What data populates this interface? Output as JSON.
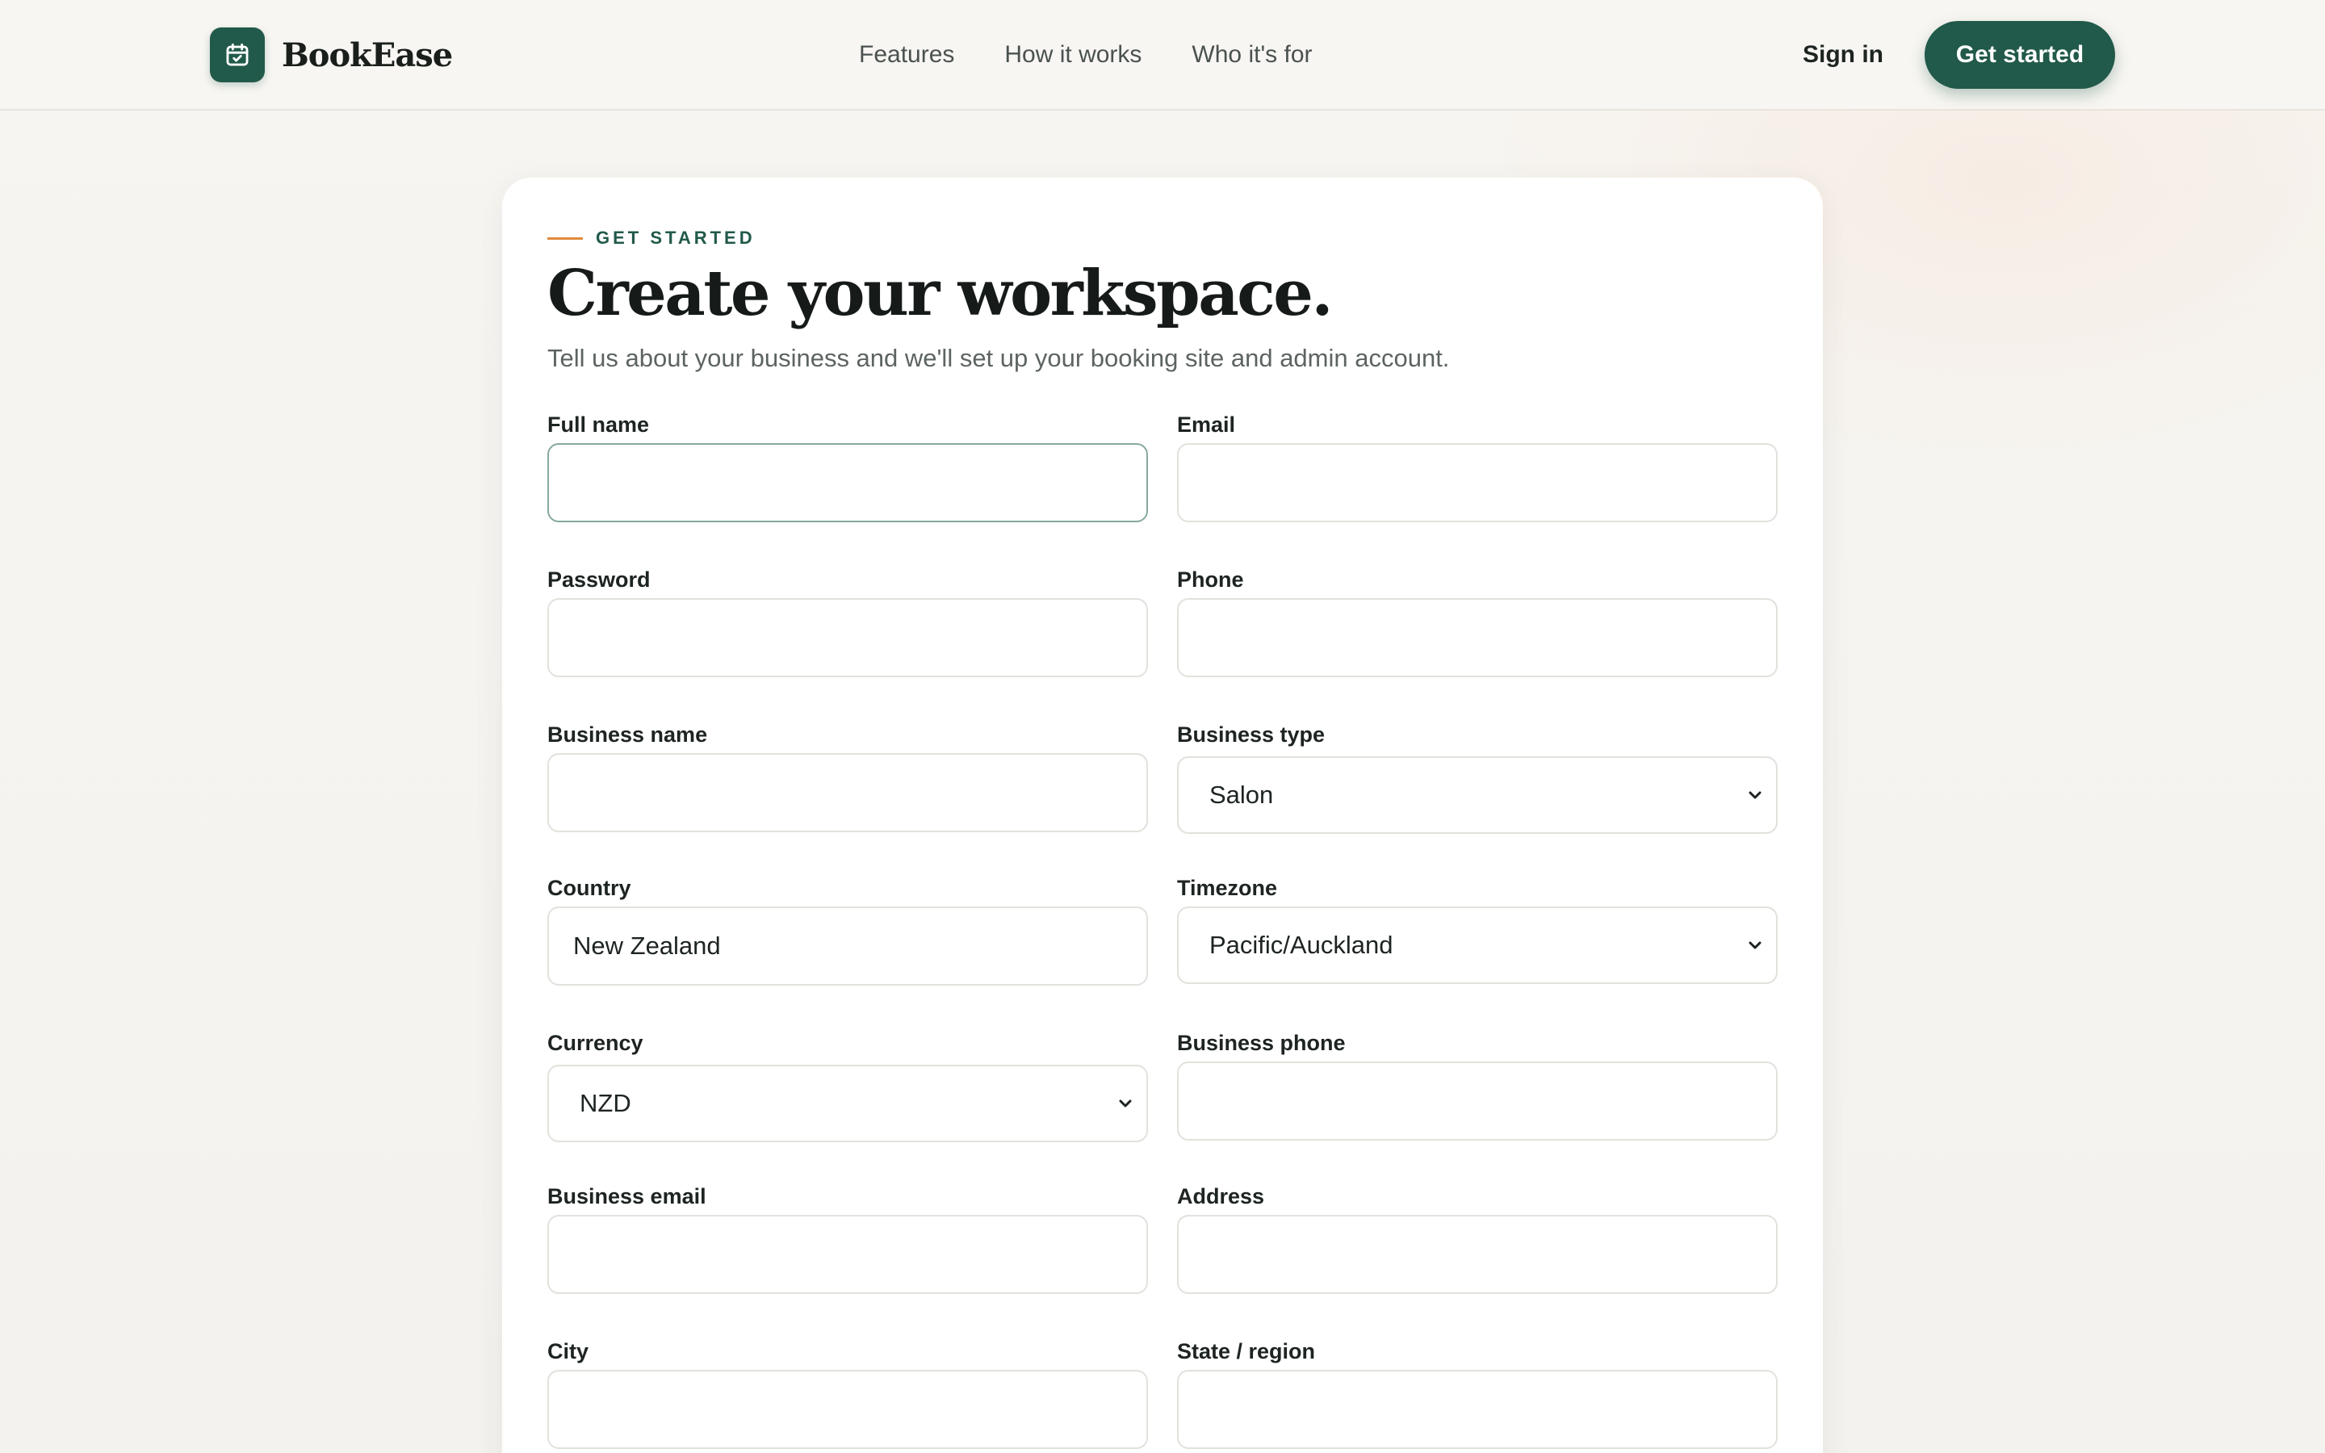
{
  "brand": {
    "name": "BookEase",
    "icon": "calendar-check-icon",
    "accent": "#21594a"
  },
  "nav": {
    "items": [
      {
        "label": "Features"
      },
      {
        "label": "How it works"
      },
      {
        "label": "Who it's for"
      }
    ],
    "sign_in": "Sign in",
    "get_started": "Get started"
  },
  "form": {
    "eyebrow": "GET STARTED",
    "title": "Create your workspace.",
    "subtitle": "Tell us about your business and we'll set up your booking site and admin account.",
    "fields": {
      "full_name": {
        "label": "Full name",
        "value": ""
      },
      "email": {
        "label": "Email",
        "value": ""
      },
      "password": {
        "label": "Password",
        "value": ""
      },
      "phone": {
        "label": "Phone",
        "value": ""
      },
      "business_name": {
        "label": "Business name",
        "value": ""
      },
      "business_type": {
        "label": "Business type",
        "value": "Salon"
      },
      "country": {
        "label": "Country",
        "value": "New Zealand"
      },
      "timezone": {
        "label": "Timezone",
        "value": "Pacific/Auckland"
      },
      "currency": {
        "label": "Currency",
        "value": "NZD"
      },
      "business_phone": {
        "label": "Business phone",
        "value": ""
      },
      "business_email": {
        "label": "Business email",
        "value": ""
      },
      "address": {
        "label": "Address",
        "value": ""
      },
      "city": {
        "label": "City",
        "value": ""
      },
      "state_region": {
        "label": "State / region",
        "value": ""
      }
    }
  }
}
